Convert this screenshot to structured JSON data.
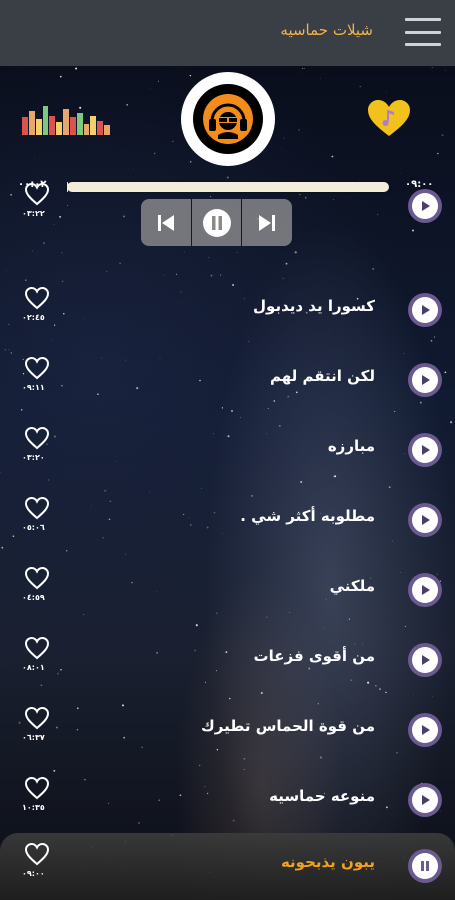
{
  "header": {
    "title": "شيلات حماسيه",
    "menu_icon": "hamburger-menu-icon"
  },
  "player": {
    "logo_icon": "headphones-logo-icon",
    "favorites_icon": "music-heart-icon",
    "elapsed": "٠٠:٠٢",
    "duration": "٠٩:٠٠",
    "progress": 0.004,
    "controls": {
      "prev_icon": "skip-previous-icon",
      "pause_icon": "pause-icon",
      "next_icon": "skip-next-icon"
    },
    "equalizer_colors": [
      "#d9534f",
      "#e8a66b",
      "#f2d06b",
      "#7fc97f",
      "#d9534f",
      "#f2d06b",
      "#e8a66b",
      "#d9534f",
      "#7fc97f",
      "#e8a66b",
      "#f2d06b",
      "#d9534f",
      "#e8a66b"
    ],
    "equalizer_levels": [
      0.55,
      0.75,
      0.5,
      0.9,
      0.6,
      0.4,
      0.8,
      0.55,
      0.7,
      0.35,
      0.6,
      0.45,
      0.3
    ]
  },
  "tracks": [
    {
      "title": "",
      "duration": "٠٣:٢٢",
      "active": false
    },
    {
      "title": "كسورا يد ديدبول",
      "duration": "٠٢:٤٥",
      "active": false
    },
    {
      "title": "لكن انتقم لهم",
      "duration": "٠٩:١١",
      "active": false
    },
    {
      "title": "مبارزه",
      "duration": "٠٣:٢٠",
      "active": false
    },
    {
      "title": "مطلوبه أكثر شي .",
      "duration": "٠٥:٠٦",
      "active": false
    },
    {
      "title": "ملكني",
      "duration": "٠٤:٥٩",
      "active": false
    },
    {
      "title": "من أقوى فزعات",
      "duration": "٠٨:٠١",
      "active": false
    },
    {
      "title": "من قوة الحماس تطيرك",
      "duration": "٠٦:٣٧",
      "active": false
    },
    {
      "title": "منوعه حماسيه",
      "duration": "١٠:٣٥",
      "active": false
    },
    {
      "title": "يبون يذبحونه",
      "duration": "٠٩:٠٠",
      "active": true
    }
  ],
  "colors": {
    "accent": "#f2b248",
    "active_title": "#f2a11c",
    "play_ring": "#6a5a90",
    "heart_gold": "#f2c21c"
  }
}
